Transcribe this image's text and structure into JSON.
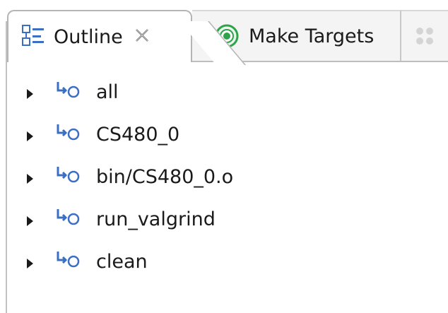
{
  "tabs": {
    "outline_label": "Outline",
    "outline_close": "✕",
    "make_targets_label": "Make Targets"
  },
  "colors": {
    "icon_blue": "#3b6fc4",
    "make_green": "#2fa34a"
  },
  "icons": {
    "outline": "outline-view-icon",
    "close": "close-icon",
    "make_targets": "make-targets-icon",
    "third_tab": "faded-view-icon",
    "row": "make-target-icon",
    "expand": "expand-arrow-icon"
  },
  "tree": {
    "items": [
      {
        "label": "all"
      },
      {
        "label": "CS480_0"
      },
      {
        "label": "bin/CS480_0.o"
      },
      {
        "label": "run_valgrind"
      },
      {
        "label": "clean"
      }
    ]
  }
}
